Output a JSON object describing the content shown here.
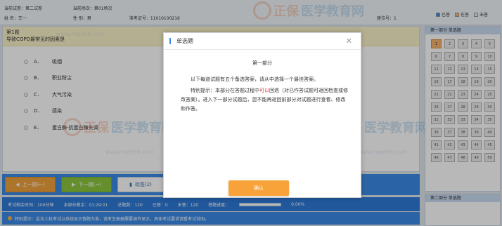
{
  "header": {
    "row1": [
      "当前试卷：第二试卷",
      "当前场次：第01场次"
    ],
    "row2": [
      "姓    名：王一",
      "性    别：男",
      "准考证号：11010100216"
    ],
    "seat": "座位号：1",
    "legend": [
      {
        "label": "已答",
        "color": "#3c8be6"
      },
      {
        "label": "在答",
        "color": "#f6b56e"
      },
      {
        "label": "未答",
        "color": "#ececec"
      }
    ]
  },
  "question": {
    "number": "第1题",
    "text": "导致COPD最常见的因素是",
    "options": [
      {
        "letter": "A．",
        "text": "吸烟"
      },
      {
        "letter": "B．",
        "text": "职业粉尘"
      },
      {
        "letter": "C．",
        "text": "大气污染"
      },
      {
        "letter": "D．",
        "text": "感染"
      },
      {
        "letter": "E．",
        "text": "蛋白酶-抗蛋白酶失调"
      }
    ]
  },
  "nav": {
    "prev": "上一题(←)",
    "next": "下一题(→)",
    "mark": "标签(2)"
  },
  "status": {
    "items": [
      "考试剩余时间：100分钟",
      "本部分剩余：01:29:01",
      "总题数：120",
      "已答：0",
      "未答：120",
      "答题进度："
    ],
    "progress": "0.00%"
  },
  "tip": "特别提示：此次上机考试以系统显示答题为准，请考生根据需要调节显示，具体考试要求请看考试说明。",
  "card": {
    "section1": "第一部分  单选题",
    "section2": "第二部分  单选题",
    "current": "1",
    "numbers": [
      "1",
      "2",
      "3",
      "4",
      "5",
      "6",
      "7",
      "8",
      "9",
      "10",
      "11",
      "12",
      "13",
      "14",
      "15",
      "16",
      "17",
      "18",
      "19",
      "20",
      "21",
      "22",
      "23",
      "24",
      "25",
      "26",
      "27",
      "28",
      "29",
      "30",
      "31",
      "32",
      "33",
      "34",
      "35",
      "36",
      "37",
      "38",
      "39",
      "40",
      "41",
      "42",
      "43",
      "44",
      "45",
      "46",
      "47",
      "48",
      "49",
      "50"
    ]
  },
  "modal": {
    "title": "单选题",
    "part": "第一部分",
    "para1": "以下每道试题有五个备选答案，请从中选择一个最佳答案。",
    "para2_prefix": "特别提示：本部分在答题过程中",
    "para2_red": "可以",
    "para2_suffix": "回退（对已作答试题可返回检查或修改答案）。进入下一部分试题后，您不能再返回前部分对试题进行查看、修改和作答。",
    "confirm": "确认"
  },
  "watermark": {
    "site": "www.med66.com",
    "brand1": "正保",
    "brand2": "医学教育网"
  }
}
